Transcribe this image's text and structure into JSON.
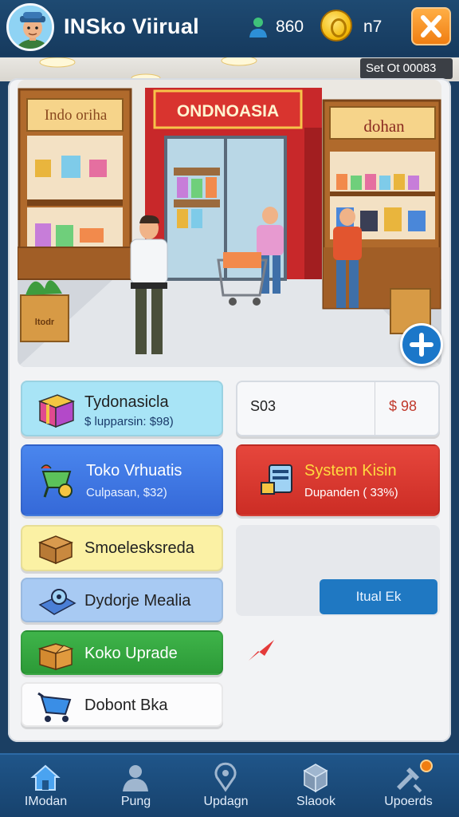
{
  "header": {
    "title": "INSko Viirual",
    "players_count": "860",
    "coins": "n7",
    "close_label": "close"
  },
  "scene": {
    "corner_badge": "Set Ot 00083",
    "left_sign": "Indo oriha",
    "center_sign": "ONDNOASIA",
    "right_sign": "dohan",
    "box_label": "ltodr"
  },
  "cards": {
    "shop": {
      "title": "Tydonasicla",
      "subtitle": "$ lupparsin: $98)"
    },
    "price": {
      "left": "S03",
      "right": "$ 98"
    },
    "virtual": {
      "title": "Toko Vrhuatis",
      "subtitle": "Culpasan, $32)"
    },
    "system": {
      "title": "System Kisin",
      "subtitle": "Dupanden ( 33%)"
    },
    "small": {
      "title": "Smoelesksreda"
    },
    "media": {
      "title": "Dydorje Mealia"
    },
    "upgrade": {
      "title": "Koko Uprade"
    },
    "bike": {
      "title": "Dobont Bka"
    },
    "virtual_button": "Itual Ek"
  },
  "nav": [
    {
      "label": "IModan",
      "icon": "home-icon"
    },
    {
      "label": "Pung",
      "icon": "profile-icon"
    },
    {
      "label": "Updagn",
      "icon": "location-icon"
    },
    {
      "label": "Slaook",
      "icon": "package-icon"
    },
    {
      "label": "Upoerds",
      "icon": "tools-icon"
    }
  ],
  "colors": {
    "topbar": "#1e4a72",
    "accent_orange": "#f07e12",
    "card_blue": "#3569d8",
    "card_red": "#cc2d25",
    "card_green": "#2c9a37",
    "nav_bg": "#1f5589"
  }
}
